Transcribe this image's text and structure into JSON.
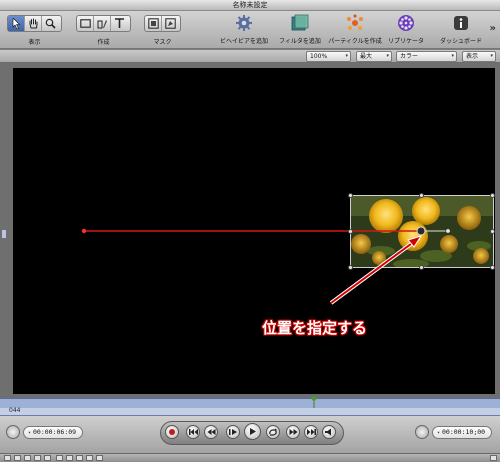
{
  "window": {
    "title": "名称未設定"
  },
  "toolbar": {
    "view_label": "表示",
    "create_label": "作成",
    "mask_label": "マスク",
    "add_behavior_label": "ビヘイビアを追加",
    "add_filter_label": "フィルタを追加",
    "make_particles_label": "パーティクルを作成",
    "replicator_label": "リプリケータ",
    "dashboard_label": "ダッシュボード",
    "overflow_label": "»"
  },
  "options": {
    "zoom_value": "100%",
    "resolution_value": "最大",
    "channels_value": "カラー",
    "view_value": "表示"
  },
  "canvas": {
    "callout": "位置を指定する",
    "callout_color": "#d40000",
    "path_color": "#d01818",
    "background": "#000000"
  },
  "timeline": {
    "frame_number": "044",
    "playhead_color": "#3a8a2a"
  },
  "transport": {
    "current_timecode": "00:00:06:09",
    "duration_timecode": "00:00:10;00"
  }
}
